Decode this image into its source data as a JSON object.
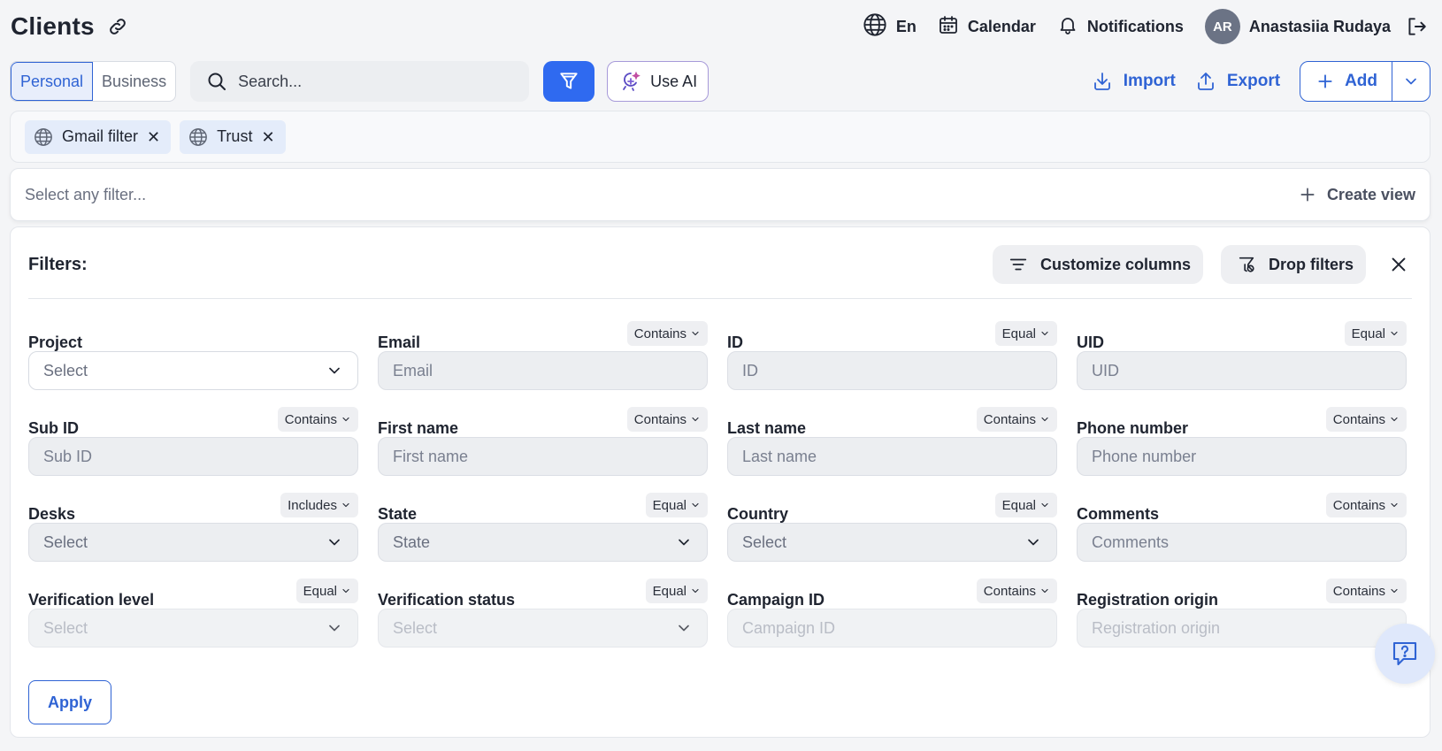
{
  "header": {
    "title": "Clients",
    "language": "En",
    "calendar": "Calendar",
    "notifications": "Notifications",
    "user": {
      "initials": "AR",
      "name": "Anastasiia Rudaya"
    }
  },
  "toolbar": {
    "tabs": [
      "Personal",
      "Business"
    ],
    "active_tab": "Personal",
    "search_placeholder": "Search...",
    "use_ai": "Use AI",
    "import": "Import",
    "export": "Export",
    "add": "Add"
  },
  "active_filters": [
    {
      "label": "Gmail filter"
    },
    {
      "label": "Trust"
    }
  ],
  "filter_select": {
    "placeholder": "Select any filter...",
    "create_view": "Create view"
  },
  "panel": {
    "title": "Filters:",
    "customize_columns": "Customize columns",
    "drop_filters": "Drop filters",
    "apply": "Apply",
    "fields": [
      {
        "label": "Project",
        "operator": "",
        "kind": "select",
        "placeholder": "Select",
        "style": "white"
      },
      {
        "label": "Email",
        "operator": "Contains",
        "kind": "input",
        "placeholder": "Email"
      },
      {
        "label": "ID",
        "operator": "Equal",
        "kind": "input",
        "placeholder": "ID"
      },
      {
        "label": "UID",
        "operator": "Equal",
        "kind": "input",
        "placeholder": "UID"
      },
      {
        "label": "Sub ID",
        "operator": "Contains",
        "kind": "input",
        "placeholder": "Sub ID"
      },
      {
        "label": "First name",
        "operator": "Contains",
        "kind": "input",
        "placeholder": "First name"
      },
      {
        "label": "Last name",
        "operator": "Contains",
        "kind": "input",
        "placeholder": "Last name"
      },
      {
        "label": "Phone number",
        "operator": "Contains",
        "kind": "input",
        "placeholder": "Phone number"
      },
      {
        "label": "Desks",
        "operator": "Includes",
        "kind": "select",
        "placeholder": "Select"
      },
      {
        "label": "State",
        "operator": "Equal",
        "kind": "select",
        "placeholder": "State"
      },
      {
        "label": "Country",
        "operator": "Equal",
        "kind": "select",
        "placeholder": "Select"
      },
      {
        "label": "Comments",
        "operator": "Contains",
        "kind": "input",
        "placeholder": "Comments"
      },
      {
        "label": "Verification level",
        "operator": "Equal",
        "kind": "select",
        "placeholder": "Select",
        "faded": true
      },
      {
        "label": "Verification status",
        "operator": "Equal",
        "kind": "select",
        "placeholder": "Select",
        "faded": true
      },
      {
        "label": "Campaign ID",
        "operator": "Contains",
        "kind": "input",
        "placeholder": "Campaign ID",
        "faded": true
      },
      {
        "label": "Registration origin",
        "operator": "Contains",
        "kind": "input",
        "placeholder": "Registration origin",
        "faded": true
      }
    ]
  },
  "colors": {
    "primary": "#2f63d4",
    "filter_button": "#2f6af0",
    "chip_bg": "#e4ecfa",
    "ai_border": "#a79ad9"
  }
}
